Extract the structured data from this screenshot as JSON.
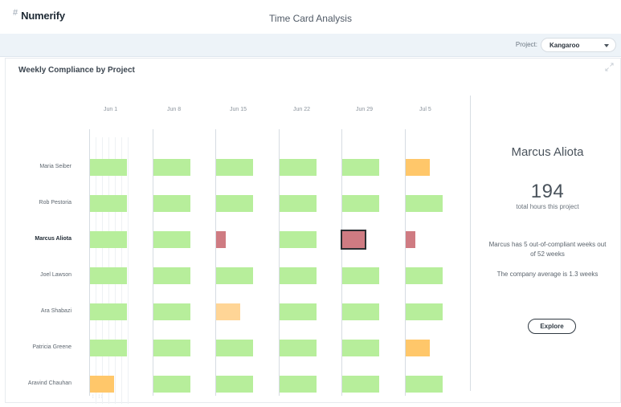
{
  "app": {
    "brand": "Numerify",
    "title": "Time Card Analysis"
  },
  "project": {
    "label": "Project:",
    "selected": "Kangaroo"
  },
  "card": {
    "title": "Weekly Compliance by Project"
  },
  "weeks": [
    "Jun 1",
    "Jun 8",
    "Jun 15",
    "Jun 22",
    "Jun 29",
    "Jul 5"
  ],
  "people": [
    "Maria Seiber",
    "Rob Pestoria",
    "Marcus Aliota",
    "Joel Lawson",
    "Ara Shabazi",
    "Patricia Greene",
    "Aravind Chauhan"
  ],
  "active_person": "Marcus Aliota",
  "compliance": [
    {
      "person": "Maria Seiber",
      "weeks": [
        "green",
        "green",
        "green",
        "green",
        "green",
        "orange"
      ]
    },
    {
      "person": "Rob Pestoria",
      "weeks": [
        "green",
        "green",
        "green",
        "green",
        "green",
        "green"
      ]
    },
    {
      "person": "Marcus Aliota",
      "weeks": [
        "green",
        "green",
        "red",
        "green",
        "red-selected",
        "red"
      ]
    },
    {
      "person": "Joel Lawson",
      "weeks": [
        "green",
        "green",
        "green",
        "green",
        "green",
        "green"
      ]
    },
    {
      "person": "Ara Shabazi",
      "weeks": [
        "green",
        "green",
        "orange-light",
        "green",
        "green",
        "green"
      ]
    },
    {
      "person": "Patricia Greene",
      "weeks": [
        "green",
        "green",
        "green",
        "green",
        "green",
        "orange"
      ]
    },
    {
      "person": "Aravind Chauhan",
      "weeks": [
        "orange",
        "green",
        "green",
        "green",
        "green",
        "green"
      ]
    }
  ],
  "colors": {
    "compliant": "#b7ee9b",
    "warning": "#ffc76a",
    "warning_light": "#ffd596",
    "non_compliant": "#cf7b82"
  },
  "detail": {
    "name": "Marcus Aliota",
    "hours": "194",
    "hours_label": "total hours this project",
    "summary": "Marcus has 5 out-of-compliant weeks out of 52 weeks",
    "average": "The company average is 1.3 weeks",
    "button": "Explore"
  },
  "icons": {
    "brand_mark": "hash-icon",
    "expand": "expand-icon",
    "dropdown": "chevron-down-icon"
  }
}
